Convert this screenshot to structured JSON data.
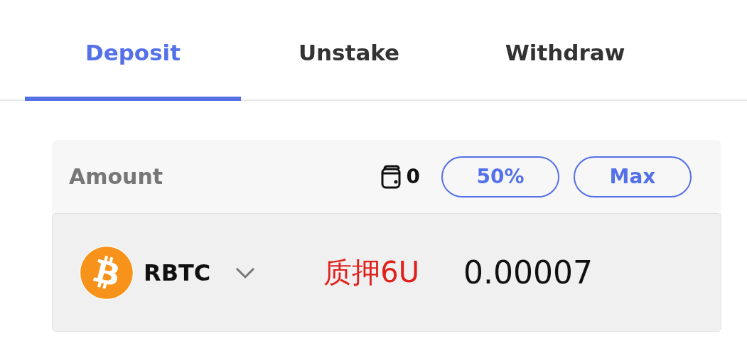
{
  "tabs": [
    {
      "label": "Deposit",
      "selected": true
    },
    {
      "label": "Unstake",
      "selected": false
    },
    {
      "label": "Withdraw",
      "selected": false
    }
  ],
  "amount": {
    "label": "Amount",
    "balance": "0",
    "buttons": [
      "50%",
      "Max"
    ]
  },
  "token": {
    "symbol": "RBTC",
    "annotation": "质押6U",
    "value": "0.00007"
  }
}
